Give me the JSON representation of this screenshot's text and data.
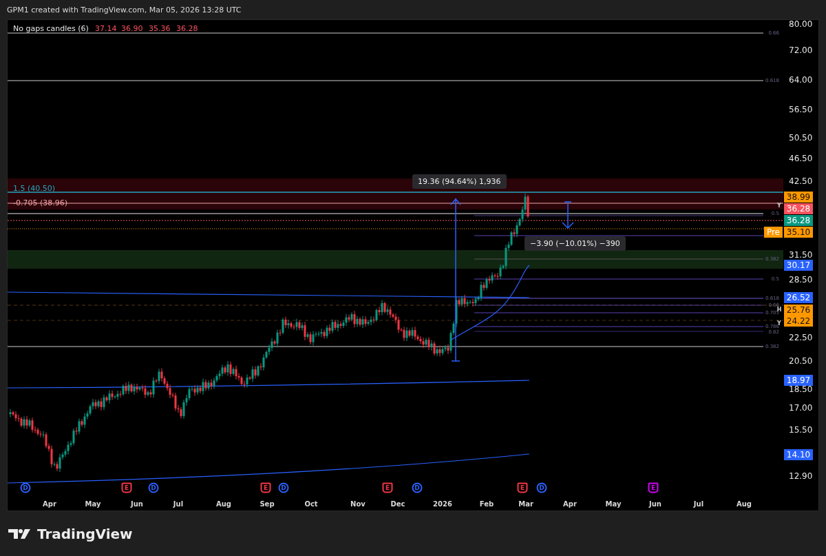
{
  "header": {
    "title": "GPM1 created with TradingView.com, Mar 05, 2026 13:28 UTC"
  },
  "legend": {
    "name": "No gaps candles (6)",
    "values": [
      "37.14",
      "36.90",
      "35.36",
      "36.28"
    ]
  },
  "level_labels": [
    {
      "text": "1.5 (40.50)",
      "color": "#26a6c2"
    },
    {
      "text": "-0.705 (38.96)",
      "color": "#f4a3a8"
    }
  ],
  "measures": [
    "19.36 (94.64%) 1,936",
    "−3.90 (−10.01%) −390"
  ],
  "fib_labels": [
    "0.66",
    "0.618",
    "0.5",
    "0.382",
    "0.5",
    "0.618",
    "0.66",
    "0.705",
    "0.786",
    "0.82",
    "0.382"
  ],
  "markers": [
    "Y",
    "H",
    "Y"
  ],
  "events": [
    {
      "kind": "dividend",
      "label": "D",
      "color": "#2962ff"
    },
    {
      "kind": "earnings",
      "label": "E",
      "color": "#f23645"
    },
    {
      "kind": "dividend",
      "label": "D",
      "color": "#2962ff"
    },
    {
      "kind": "earnings",
      "label": "E",
      "color": "#f23645"
    },
    {
      "kind": "dividend",
      "label": "D",
      "color": "#2962ff"
    },
    {
      "kind": "earnings",
      "label": "E",
      "color": "#f23645"
    },
    {
      "kind": "dividend",
      "label": "D",
      "color": "#2962ff"
    },
    {
      "kind": "earnings",
      "label": "E",
      "color": "#f23645"
    },
    {
      "kind": "dividend",
      "label": "D",
      "color": "#2962ff"
    },
    {
      "kind": "earnings",
      "label": "E",
      "color": "#d500f9"
    }
  ],
  "price_axis": {
    "ticks": [
      "80.00",
      "72.00",
      "64.00",
      "56.50",
      "50.50",
      "46.50",
      "42.50",
      "31.50",
      "28.50",
      "22.50",
      "20.50",
      "18.50",
      "17.00",
      "15.50",
      "12.90"
    ],
    "badges": [
      {
        "text": "38.99",
        "color": "#ff9800"
      },
      {
        "text": "36.28",
        "color": "#f7525f"
      },
      {
        "text": "36.28",
        "color": "#089981"
      },
      {
        "text": "35.10",
        "color": "#ff9800",
        "tag": "Pre"
      },
      {
        "text": "30.17",
        "color": "#2962ff"
      },
      {
        "text": "26.52",
        "color": "#2962ff"
      },
      {
        "text": "25.76",
        "color": "#ff9800"
      },
      {
        "text": "24.22",
        "color": "#ff9800"
      },
      {
        "text": "18.97",
        "color": "#2962ff"
      },
      {
        "text": "14.10",
        "color": "#2962ff"
      }
    ]
  },
  "time_axis": [
    "Apr",
    "May",
    "Jun",
    "Jul",
    "Aug",
    "Sep",
    "Oct",
    "Nov",
    "Dec",
    "2026",
    "Feb",
    "Mar",
    "Apr",
    "May",
    "Jun",
    "Jul",
    "Aug"
  ],
  "footer": {
    "brand": "TradingView"
  }
}
